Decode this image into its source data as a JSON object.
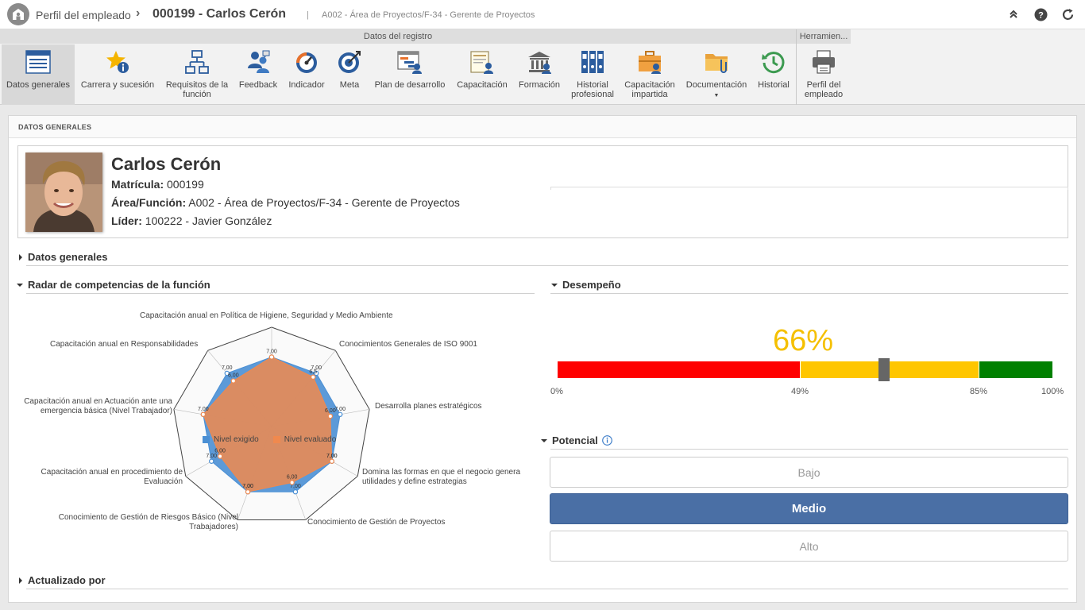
{
  "header": {
    "module": "Perfil del empleado",
    "record": "000199 - Carlos Cerón",
    "path": "A002 - Área de Proyectos/F-34 - Gerente de Proyectos",
    "pipe": "|"
  },
  "ribbon": {
    "group1": "Datos del registro",
    "group2": "Herramien...",
    "buttons": [
      {
        "label": "Datos generales",
        "icon": "form-icon"
      },
      {
        "label": "Carrera y sucesión",
        "icon": "star-info-icon"
      },
      {
        "label": "Requisitos de la función",
        "icon": "org-chart-icon"
      },
      {
        "label": "Feedback",
        "icon": "people-feedback-icon"
      },
      {
        "label": "Indicador",
        "icon": "gauge-icon"
      },
      {
        "label": "Meta",
        "icon": "target-icon"
      },
      {
        "label": "Plan de desarrollo",
        "icon": "gantt-icon"
      },
      {
        "label": "Capacitación",
        "icon": "certificate-icon"
      },
      {
        "label": "Formación",
        "icon": "institution-icon"
      },
      {
        "label": "Historial profesional",
        "icon": "binders-icon"
      },
      {
        "label": "Capacitación impartida",
        "icon": "briefcase-user-icon"
      },
      {
        "label": "Documentación",
        "icon": "folder-clip-icon"
      },
      {
        "label": "Historial",
        "icon": "history-icon"
      },
      {
        "label": "Perfil del empleado",
        "icon": "printer-icon"
      }
    ]
  },
  "section_header": "DATOS GENERALES",
  "profile": {
    "name": "Carlos Cerón",
    "matricula_label": "Matrícula:",
    "matricula": "000199",
    "area_label": "Área/Función:",
    "area": "A002 - Área de Proyectos/F-34 - Gerente de Proyectos",
    "lider_label": "Líder:",
    "lider": "100222 - Javier González"
  },
  "sections": {
    "datos_generales": "Datos generales",
    "radar": "Radar de competencias de la función",
    "desempeno": "Desempeño",
    "potencial": "Potencial",
    "actualizado": "Actualizado por"
  },
  "chart_data": {
    "type": "radar",
    "categories": [
      "Capacitación anual en Política de Higiene, Seguridad y Medio Ambiente",
      "Conocimientos Generales de ISO 9001",
      "Desarrolla planes estratégicos",
      "Domina las formas en que el negocio genera utilidades y define estrategias",
      "Conocimiento de Gestión de Proyectos",
      "Conocimiento de Gestión de Riesgos Básico (Nivel Trabajadores)",
      "Capacitación anual en procedimiento de Evaluación",
      "Capacitación anual en Actuación ante una emergencia básica (Nivel Trabajador)",
      "Capacitación anual en Responsabilidades"
    ],
    "rmax": 10,
    "series": [
      {
        "name": "Nivel exigido",
        "color": "#4a8fd4",
        "values": [
          7,
          7,
          7,
          7,
          7,
          7,
          7,
          7,
          7
        ]
      },
      {
        "name": "Nivel evaluado",
        "color": "#f0894e",
        "values": [
          7,
          6.5,
          6,
          7,
          6,
          7,
          6,
          7,
          6
        ]
      }
    ],
    "value_labels": [
      [
        "7,00",
        "7,00",
        "7,00",
        "7,00",
        "7,00",
        "7,00",
        "7,00",
        "7,00",
        "7,00"
      ],
      [
        "",
        "6,5",
        "6,00",
        "7,00",
        "6,00",
        "7,00",
        "6,00",
        "",
        "6,00"
      ]
    ]
  },
  "performance": {
    "value": 66,
    "display": "66%",
    "thresholds": [
      49,
      85
    ],
    "labels": [
      "0%",
      "49%",
      "85%",
      "100%"
    ],
    "colors": {
      "low": "#ff0000",
      "mid": "#ffc600",
      "high": "#008000",
      "marker": "#666666"
    }
  },
  "potential": {
    "options": [
      "Bajo",
      "Medio",
      "Alto"
    ],
    "selected": "Medio"
  }
}
